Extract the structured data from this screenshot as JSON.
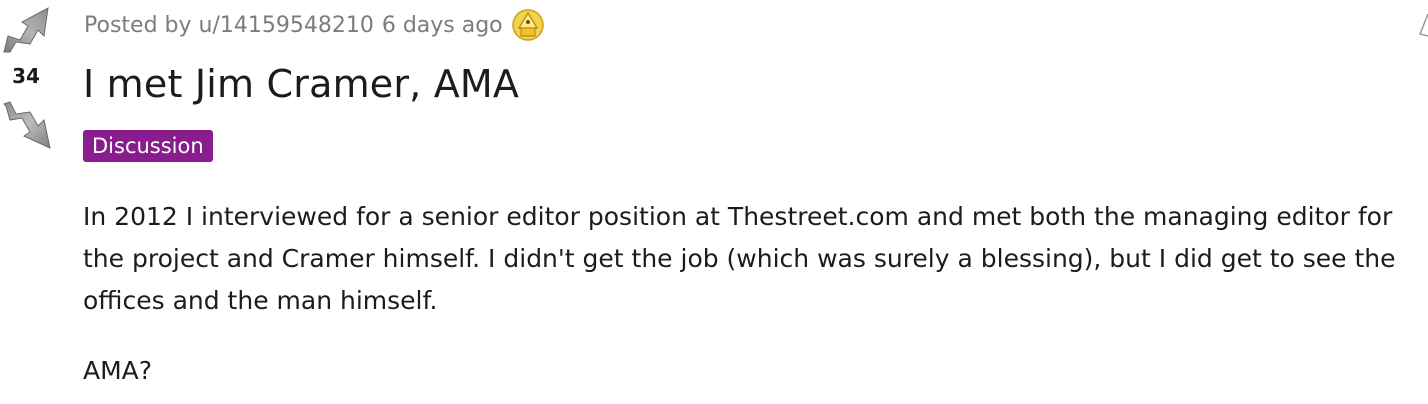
{
  "post": {
    "score": "34",
    "meta": {
      "posted_by": "Posted by u/14159548210",
      "time_ago": "6 days ago",
      "award_icon": "award-icon"
    },
    "title": "I met Jim Cramer, AMA",
    "flair": {
      "label": "Discussion",
      "color": "#8a1d8d"
    },
    "body": [
      "In 2012 I interviewed for a senior editor position at Thestreet.com and met both the managing editor for the project and Cramer himself. I didn't get the job (which was surely a blessing), but I did get to see the offices and the man himself.",
      "AMA?"
    ],
    "icons": {
      "upvote": "upvote-arrow-icon",
      "downvote": "downvote-arrow-icon"
    }
  }
}
